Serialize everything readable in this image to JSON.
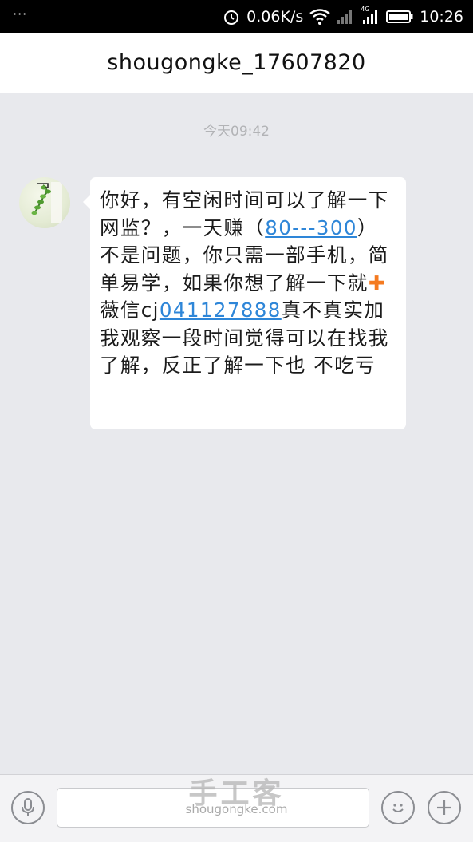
{
  "status_bar": {
    "menu_dots": "···",
    "net_speed": "0.06K/s",
    "network_label": "4G",
    "time": "10:26"
  },
  "header": {
    "title": "shougongke_17607820"
  },
  "chat": {
    "timestamp": "今天09:42",
    "message": {
      "part1": "你好，有空闲时间可以了解一下网监？，一天赚（",
      "link_amount": "80---300",
      "part2": "）不是问题，你只需一部手机，简单易学，如果你想了解一下就",
      "plus_symbol": "✚",
      "part3": "薇信cj",
      "link_id": "041127888",
      "part4": "真不真实加我观察一段时间觉得可以在找我了解，反正了解一下也 不吃亏"
    }
  },
  "input_bar": {
    "watermark_cn": "手工客",
    "watermark_en": "shougongke.com"
  },
  "colors": {
    "link": "#2e86d8",
    "plus": "#f47a20",
    "chat_bg": "#e8e9ed"
  }
}
